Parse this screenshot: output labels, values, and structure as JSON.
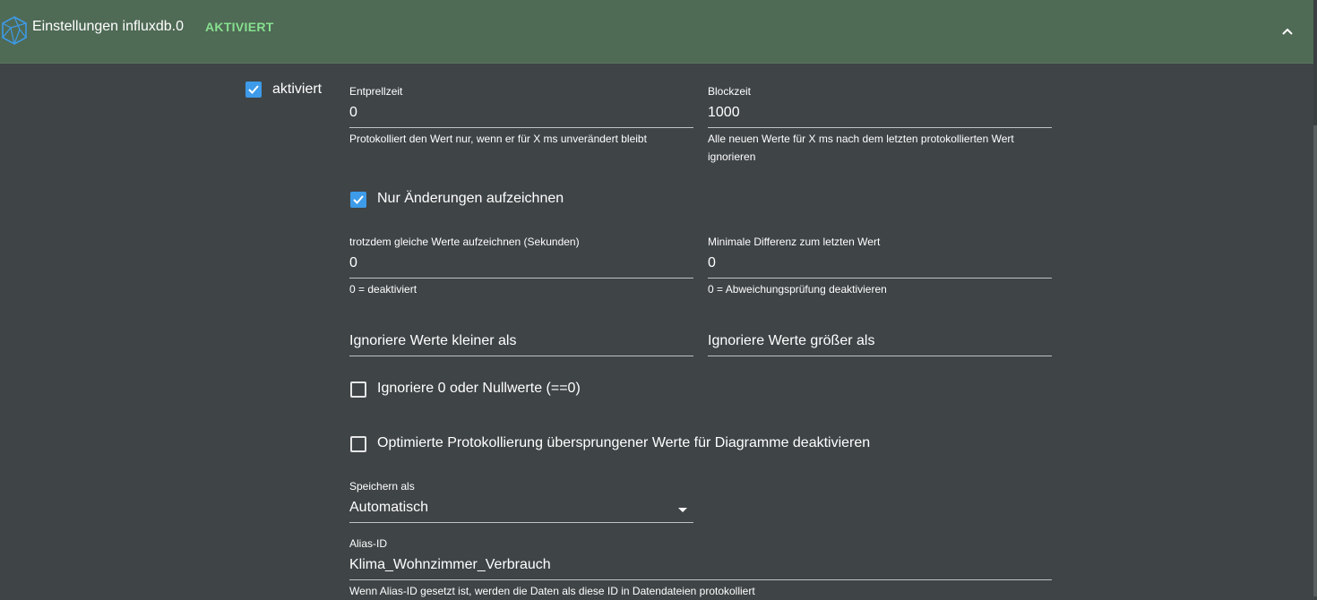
{
  "header": {
    "title": "Einstellungen influxdb.0",
    "status": "AKTIVIERT",
    "logo_icon": "influxdb-cube-icon",
    "collapse_icon": "chevron-up-icon"
  },
  "enabled": {
    "label": "aktiviert",
    "checked": true
  },
  "debounce": {
    "label": "Entprellzeit",
    "value": "0",
    "help": "Protokolliert den Wert nur, wenn er für X ms unverändert bleibt"
  },
  "blocktime": {
    "label": "Blockzeit",
    "value": "1000",
    "help": "Alle neuen Werte für X ms nach dem letzten protokollierten Wert ignorieren"
  },
  "changes_only": {
    "label": "Nur Änderungen aufzeichnen",
    "checked": true
  },
  "changes_relog": {
    "label": "trotzdem gleiche Werte aufzeichnen (Sekunden)",
    "value": "0",
    "help": "0 = deaktiviert"
  },
  "changes_min_delta": {
    "label": "Minimale Differenz zum letzten Wert",
    "value": "0",
    "help": "0 = Abweichungsprüfung deaktivieren"
  },
  "ignore_below": {
    "placeholder": "Ignoriere Werte kleiner als",
    "value": ""
  },
  "ignore_above": {
    "placeholder": "Ignoriere Werte größer als",
    "value": ""
  },
  "ignore_zero": {
    "label": "Ignoriere 0 oder Nullwerte (==0)",
    "checked": false
  },
  "disable_skipped": {
    "label": "Optimierte Protokollierung übersprungener Werte für Diagramme deaktivieren",
    "checked": false
  },
  "store_as": {
    "label": "Speichern als",
    "value": "Automatisch"
  },
  "alias_id": {
    "label": "Alias-ID",
    "value": "Klima_Wohnzimmer_Verbrauch",
    "help": "Wenn Alias-ID gesetzt ist, werden die Daten als diese ID in Datendateien protokolliert"
  },
  "colors": {
    "header_bg": "#4f6a55",
    "page_bg": "#3f4446",
    "status_green": "#86e08f",
    "checkbox_blue": "#3d9be9"
  }
}
